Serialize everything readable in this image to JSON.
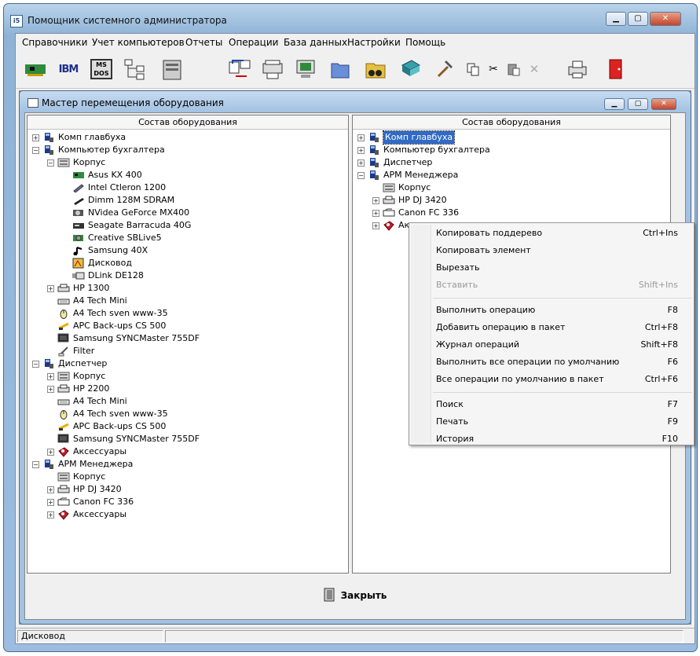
{
  "window": {
    "title": "Помощник системного администратора",
    "icon": "app-icon",
    "min": "▁",
    "max": "▢",
    "close": "✕"
  },
  "menu": [
    "Справочники",
    "Учет компьютеров",
    "Отчеты",
    "Операции",
    "База данных",
    "Настройки",
    "Помощь"
  ],
  "toolbar": [
    "network-card-icon",
    "ibm-icon",
    "ms-dos-icon",
    "tree-icon",
    "computer-case-icon",
    "transfer-icon",
    "scanner-icon",
    "monitor-chip-icon",
    "folder-icon",
    "binoculars-icon",
    "book-icon",
    "hammer-icon",
    "copy-icon",
    "cut-icon",
    "paste-icon",
    "delete-icon",
    "printer-icon",
    "exit-door-icon"
  ],
  "toolbar_text": {
    "ibm": "IBM",
    "msdos": "MS DOS"
  },
  "child": {
    "title": "Мастер перемещения оборудования",
    "min": "▁",
    "max": "▢",
    "close": "✕"
  },
  "left_panel": {
    "header": "Состав оборудования",
    "items": [
      {
        "label": "Комп главбуха",
        "level": 0,
        "exp": "+",
        "icon": "computer-icon"
      },
      {
        "label": "Компьютер бухгалтера",
        "level": 0,
        "exp": "−",
        "icon": "computer-icon"
      },
      {
        "label": "Корпус",
        "level": 1,
        "exp": "−",
        "icon": "case-icon"
      },
      {
        "label": "Asus KX 400",
        "level": 2,
        "exp": "",
        "icon": "motherboard-icon"
      },
      {
        "label": "Intel Ctleron 1200",
        "level": 2,
        "exp": "",
        "icon": "cpu-icon"
      },
      {
        "label": "Dimm 128M SDRAM",
        "level": 2,
        "exp": "",
        "icon": "ram-icon"
      },
      {
        "label": "NVidea GeForce MX400",
        "level": 2,
        "exp": "",
        "icon": "video-card-icon"
      },
      {
        "label": "Seagate Barracuda 40G",
        "level": 2,
        "exp": "",
        "icon": "hdd-icon"
      },
      {
        "label": "Creative SBLive5",
        "level": 2,
        "exp": "",
        "icon": "sound-card-icon"
      },
      {
        "label": "Samsung 40X",
        "level": 2,
        "exp": "",
        "icon": "cdrom-icon"
      },
      {
        "label": "Дисковод",
        "level": 2,
        "exp": "",
        "icon": "floppy-icon"
      },
      {
        "label": "DLink DE128",
        "level": 2,
        "exp": "",
        "icon": "nic-icon"
      },
      {
        "label": "HP 1300",
        "level": 1,
        "exp": "+",
        "icon": "printer-icon"
      },
      {
        "label": "A4 Tech Mini",
        "level": 1,
        "exp": "",
        "icon": "keyboard-icon"
      },
      {
        "label": "A4 Tech sven www-35",
        "level": 1,
        "exp": "",
        "icon": "mouse-icon"
      },
      {
        "label": "APC Back-ups CS 500",
        "level": 1,
        "exp": "",
        "icon": "ups-icon"
      },
      {
        "label": "Samsung SYNCMaster 755DF",
        "level": 1,
        "exp": "",
        "icon": "monitor-icon"
      },
      {
        "label": "Filter",
        "level": 1,
        "exp": "",
        "icon": "filter-icon"
      },
      {
        "label": "Диспетчер",
        "level": 0,
        "exp": "−",
        "icon": "computer-icon"
      },
      {
        "label": "Корпус",
        "level": 1,
        "exp": "+",
        "icon": "case-icon"
      },
      {
        "label": "HP 2200",
        "level": 1,
        "exp": "+",
        "icon": "printer-icon"
      },
      {
        "label": "A4 Tech Mini",
        "level": 1,
        "exp": "",
        "icon": "keyboard-icon"
      },
      {
        "label": "A4 Tech sven www-35",
        "level": 1,
        "exp": "",
        "icon": "mouse-icon"
      },
      {
        "label": "APC Back-ups CS 500",
        "level": 1,
        "exp": "",
        "icon": "ups-icon"
      },
      {
        "label": "Samsung SYNCMaster 755DF",
        "level": 1,
        "exp": "",
        "icon": "monitor-icon"
      },
      {
        "label": "Аксессуары",
        "level": 1,
        "exp": "+",
        "icon": "accessories-icon"
      },
      {
        "label": "АРМ Менеджера",
        "level": 0,
        "exp": "−",
        "icon": "computer-icon"
      },
      {
        "label": "Корпус",
        "level": 1,
        "exp": "",
        "icon": "case-icon"
      },
      {
        "label": "HP DJ 3420",
        "level": 1,
        "exp": "+",
        "icon": "printer-icon"
      },
      {
        "label": "Canon FC 336",
        "level": 1,
        "exp": "+",
        "icon": "copier-icon"
      },
      {
        "label": "Аксессуары",
        "level": 1,
        "exp": "+",
        "icon": "accessories-icon"
      }
    ]
  },
  "right_panel": {
    "header": "Состав оборудования",
    "items": [
      {
        "label": "Комп главбуха",
        "level": 0,
        "exp": "+",
        "icon": "computer-icon",
        "selected": true
      },
      {
        "label": "Компьютер бухгалтера",
        "level": 0,
        "exp": "+",
        "icon": "computer-icon"
      },
      {
        "label": "Диспетчер",
        "level": 0,
        "exp": "+",
        "icon": "computer-icon"
      },
      {
        "label": "АРМ Менеджера",
        "level": 0,
        "exp": "−",
        "icon": "computer-icon"
      },
      {
        "label": "Корпус",
        "level": 1,
        "exp": "",
        "icon": "case-icon"
      },
      {
        "label": "HP DJ 3420",
        "level": 1,
        "exp": "+",
        "icon": "printer-icon"
      },
      {
        "label": "Canon FC 336",
        "level": 1,
        "exp": "+",
        "icon": "copier-icon"
      },
      {
        "label": "Аксессуары",
        "level": 1,
        "exp": "+",
        "icon": "accessories-icon"
      }
    ]
  },
  "close_button": {
    "label": "Закрыть",
    "icon": "door-icon"
  },
  "status": {
    "text": "Дисковод"
  },
  "context_menu": {
    "groups": [
      [
        {
          "label": "Копировать поддерево",
          "shortcut": "Ctrl+Ins",
          "disabled": false
        },
        {
          "label": "Копировать элемент",
          "shortcut": "",
          "disabled": false
        },
        {
          "label": "Вырезать",
          "shortcut": "",
          "disabled": false
        },
        {
          "label": "Вставить",
          "shortcut": "Shift+Ins",
          "disabled": true
        }
      ],
      [
        {
          "label": "Выполнить операцию",
          "shortcut": "F8",
          "disabled": false
        },
        {
          "label": "Добавить операцию в пакет",
          "shortcut": "Ctrl+F8",
          "disabled": false
        },
        {
          "label": "Журнал операций",
          "shortcut": "Shift+F8",
          "disabled": false
        },
        {
          "label": "Выполнить все операции по умолчанию",
          "shortcut": "F6",
          "disabled": false
        },
        {
          "label": "Все операции по умолчанию в пакет",
          "shortcut": "Ctrl+F6",
          "disabled": false
        }
      ],
      [
        {
          "label": "Поиск",
          "shortcut": "F7",
          "disabled": false
        },
        {
          "label": "Печать",
          "shortcut": "F9",
          "disabled": false
        },
        {
          "label": "История",
          "shortcut": "F10",
          "disabled": false
        }
      ]
    ]
  },
  "colors": {
    "selection": "#316ac5",
    "disabled_text": "#9a9a9a",
    "title_gradient_top": "#b9d3ea"
  }
}
